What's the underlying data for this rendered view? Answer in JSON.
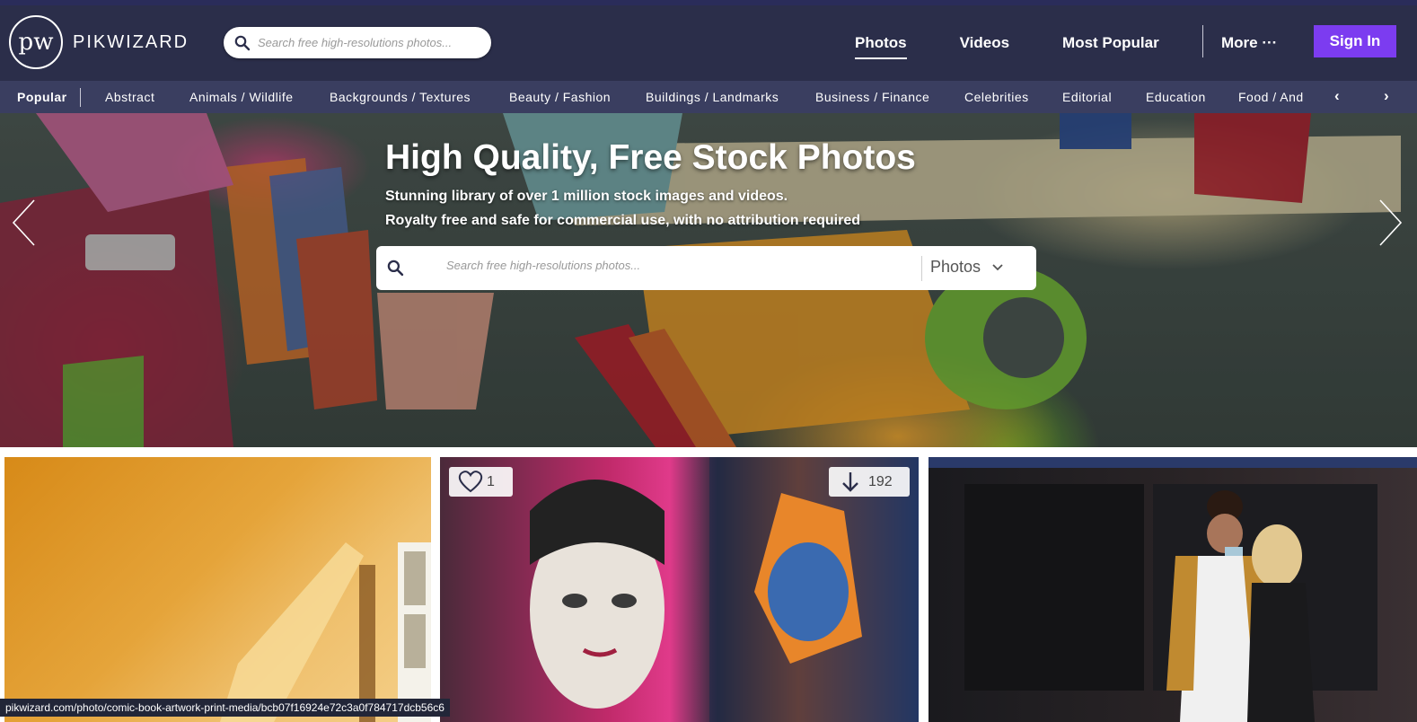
{
  "header": {
    "logo_mark": "pw",
    "logo_text": "PIKWIZARD",
    "search_placeholder": "Search free high-resolutions photos...",
    "nav": [
      {
        "label": "Photos",
        "active": true
      },
      {
        "label": "Videos"
      },
      {
        "label": "Most Popular"
      }
    ],
    "more_label": "More ···",
    "signin_label": "Sign In"
  },
  "categories": [
    "Popular",
    "Abstract",
    "Animals / Wildlife",
    "Backgrounds / Textures",
    "Beauty / Fashion",
    "Buildings / Landmarks",
    "Business / Finance",
    "Celebrities",
    "Editorial",
    "Education",
    "Food / And"
  ],
  "hero": {
    "title": "High Quality, Free Stock Photos",
    "subtitle_1": "Stunning library of over 1 million stock images and videos.",
    "subtitle_2": "Royalty free and safe for commercial use, with no attribution required",
    "search_placeholder": "Search free high-resolutions photos...",
    "type_select": "Photos"
  },
  "tiles": {
    "likes": "1",
    "downloads": "192"
  },
  "status_url": "pikwizard.com/photo/comic-book-artwork-print-media/bcb07f16924e72c3a0f784717dcb56c6",
  "colors": {
    "header_bg": "#2b2e4a",
    "category_bar_bg": "#3a3e60",
    "signin_bg": "#7c3cf0"
  }
}
